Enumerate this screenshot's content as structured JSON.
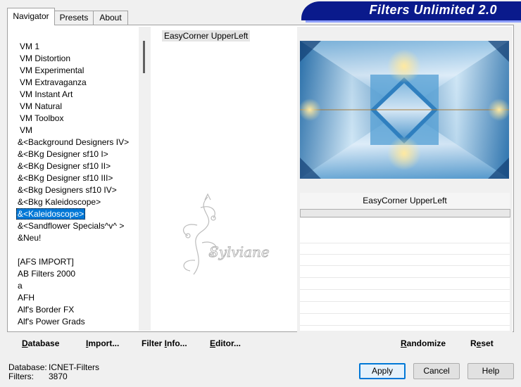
{
  "tabs": [
    "Navigator",
    "Presets",
    "About"
  ],
  "banner_title": "Filters Unlimited 2.0",
  "categories": [
    "VM 1",
    "VM Distortion",
    "VM Experimental",
    "VM Extravaganza",
    "VM Instant Art",
    "VM Natural",
    "VM Toolbox",
    "VM",
    "&<Background Designers IV>",
    "&<BKg Designer sf10 I>",
    "&<BKg Designer sf10 II>",
    "&<BKg Designer sf10 III>",
    "&<Bkg Designers sf10 IV>",
    "&<Bkg Kaleidoscope>",
    "&<Kaleidoscope>",
    "&<Sandflower Specials^v^ >",
    "&Neu!",
    "",
    "[AFS IMPORT]",
    "AB Filters 2000",
    "a",
    "AFH",
    "Alf's Border FX",
    "Alf's Power Grads"
  ],
  "selected_category_index": 14,
  "filters": [
    "EasyCorner UpperLeft"
  ],
  "preview": {
    "filter_name": "EasyCorner UpperLeft"
  },
  "watermark_text": "Sylviane",
  "bottom_links": {
    "database": {
      "ul": "D",
      "rest": "atabase"
    },
    "import": {
      "ul": "I",
      "rest": "mport..."
    },
    "filter_info": {
      "pre": "Filter ",
      "ul": "I",
      "rest": "nfo..."
    },
    "editor": {
      "ul": "E",
      "rest": "ditor..."
    },
    "randomize": {
      "ul": "R",
      "rest": "andomize"
    },
    "reset": {
      "pre": "R",
      "ul": "e",
      "rest": "set"
    }
  },
  "status": {
    "database_label": "Database:",
    "database_value": "ICNET-Filters",
    "filters_label": "Filters:",
    "filters_value": "3870"
  },
  "buttons": {
    "apply": "Apply",
    "cancel": "Cancel",
    "help": "Help"
  },
  "colors": {
    "banner": "#0a1a8c",
    "selection": "#0078d7"
  }
}
